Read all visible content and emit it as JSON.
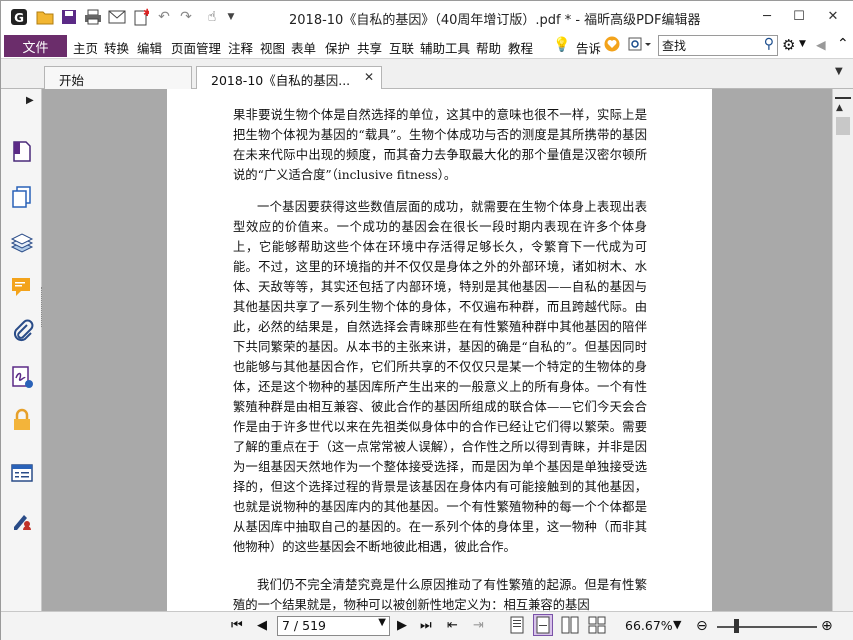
{
  "title_bar": {
    "title": "2018-10《自私的基因》（40周年增订版）.pdf * - 福昕高级PDF编辑器",
    "minimize": "─",
    "maximize": "☐",
    "close": "✕"
  },
  "menu": {
    "file": "文件",
    "items": [
      "主页",
      "转换",
      "编辑",
      "页面管理",
      "注释",
      "视图",
      "表单",
      "保护",
      "共享",
      "互联",
      "辅助工具",
      "帮助",
      "教程"
    ],
    "tell": "告诉",
    "search_value": "查找"
  },
  "tabs": [
    {
      "label": "开始"
    },
    {
      "label": "2018-10《自私的基因...",
      "close": "✕"
    }
  ],
  "document": {
    "paragraphs": [
      "果非要说生物个体是自然选择的单位，这其中的意味也很不一样，实际上是把生物个体视为基因的“载具”。生物个体成功与否的测度是其所携带的基因在未来代际中出现的频度，而其奋力去争取最大化的那个量值是汉密尔顿所说的“广义适合度”（inclusive fitness）。",
      "一个基因要获得这些数值层面的成功，就需要在生物个体身上表现出表型效应的价值来。一个成功的基因会在很长一段时期内表现在许多个体身上，它能够帮助这些个体在环境中存活得足够长久，令繁育下一代成为可能。不过，这里的环境指的并不仅仅是身体之外的外部环境，诸如树木、水体、天敌等等，其实还包括了内部环境，特别是其他基因——自私的基因与其他基因共享了一系列生物个体的身体，不仅遍布种群，而且跨越代际。由此，必然的结果是，自然选择会青睐那些在有性繁殖种群中其他基因的陪伴下共同繁荣的基因。从本书的主张来讲，基因的确是“自私的”。但基因同时也能够与其他基因合作，它们所共享的不仅仅只是某一个特定的生物体的身体，还是这个物种的基因库所产生出来的一般意义上的所有身体。一个有性繁殖种群是由相互兼容、彼此合作的基因所组成的联合体——它们今天会合作是由于许多世代以来在先祖类似身体中的合作已经让它们得以繁荣。需要了解的重点在于（这一点常常被人误解），合作性之所以得到青睐，并非是因为一组基因天然地作为一个整体接受选择，而是因为单个基因是单独接受选择的，但这个选择过程的背景是该基因在身体内有可能接触到的其他基因，也就是说物种的基因库内的其他基因。一个有性繁殖物种的每一个个体都是从基因库中抽取自己的基因的。在一系列个体的身体里，这一物种（而非其他物种）的这些基因会不断地彼此相遇，彼此合作。",
      "我们仍不完全清楚究竟是什么原因推动了有性繁殖的起源。但是有性繁殖的一个结果就是，物种可以被创新性地定义为：相互兼容的基因"
    ]
  },
  "status": {
    "page_indicator": "7 / 519",
    "zoom": "66.67%",
    "zoom_fraction": 0.6667
  }
}
